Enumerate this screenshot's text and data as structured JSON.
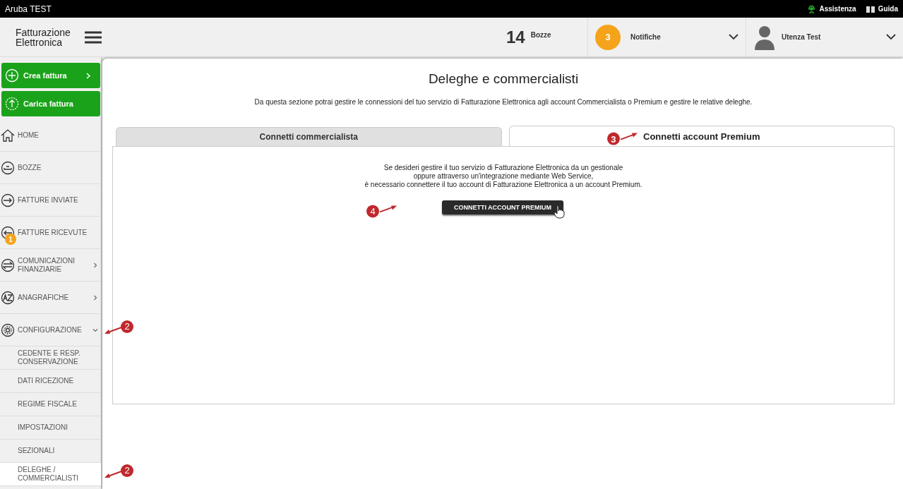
{
  "top_bar": {
    "title": "Aruba TEST",
    "links": [
      "Assistenza",
      "Guida"
    ]
  },
  "header": {
    "logo": [
      "Fatturazione",
      "Elettronica"
    ],
    "drafts_count": "14",
    "drafts_label": "Bozze",
    "notifications_count": "3",
    "notifications_label": "Notifiche",
    "user_name": "Utenza Test"
  },
  "actions": [
    "Crea fattura",
    "Carica fattura"
  ],
  "nav": [
    {
      "label": "HOME"
    },
    {
      "label": "BOZZE"
    },
    {
      "label": "FATTURE INVIATE"
    },
    {
      "label": "FATTURE RICEVUTE",
      "badge": "1"
    },
    {
      "label": "COMUNICAZIONI FINANZIARIE",
      "expanded": false
    },
    {
      "label": "ANAGRAFICHE",
      "expanded": false
    },
    {
      "label": "CONFIGURAZIONE",
      "expanded": true,
      "callout": "2",
      "children": [
        {
          "label": "CEDENTE E RESP. CONSERVAZIONE",
          "selected": false
        },
        {
          "label": "DATI RICEZIONE",
          "selected": false
        },
        {
          "label": "REGIME FISCALE",
          "selected": false
        },
        {
          "label": "IMPOSTAZIONI",
          "selected": false
        },
        {
          "label": "SEZIONALI",
          "selected": false
        },
        {
          "label": "DELEGHE / COMMERCIALISTI",
          "selected": true,
          "callout": "2"
        }
      ]
    }
  ],
  "page": {
    "title": "Deleghe e commercialisti",
    "description": "Da questa sezione potrai gestire le connessioni del tuo servizio di Fatturazione Elettronica agli account Commercialista o Premium e gestire le relative deleghe.",
    "tabs": [
      {
        "label": "Connetti commercialista",
        "selected": false
      },
      {
        "label": "Connetti account Premium",
        "selected": true,
        "callout": "3"
      }
    ],
    "message": [
      "Se desideri gestire il tuo servizio di Fatturazione Elettronica da un gestionale",
      "oppure attraverso un'integrazione mediante Web Service,",
      "è necessario connettere il tuo account di Fatturazione Elettronica a un account Premium."
    ],
    "button": {
      "label": "CONNETTI ACCOUNT PREMIUM",
      "callout": "4"
    }
  }
}
